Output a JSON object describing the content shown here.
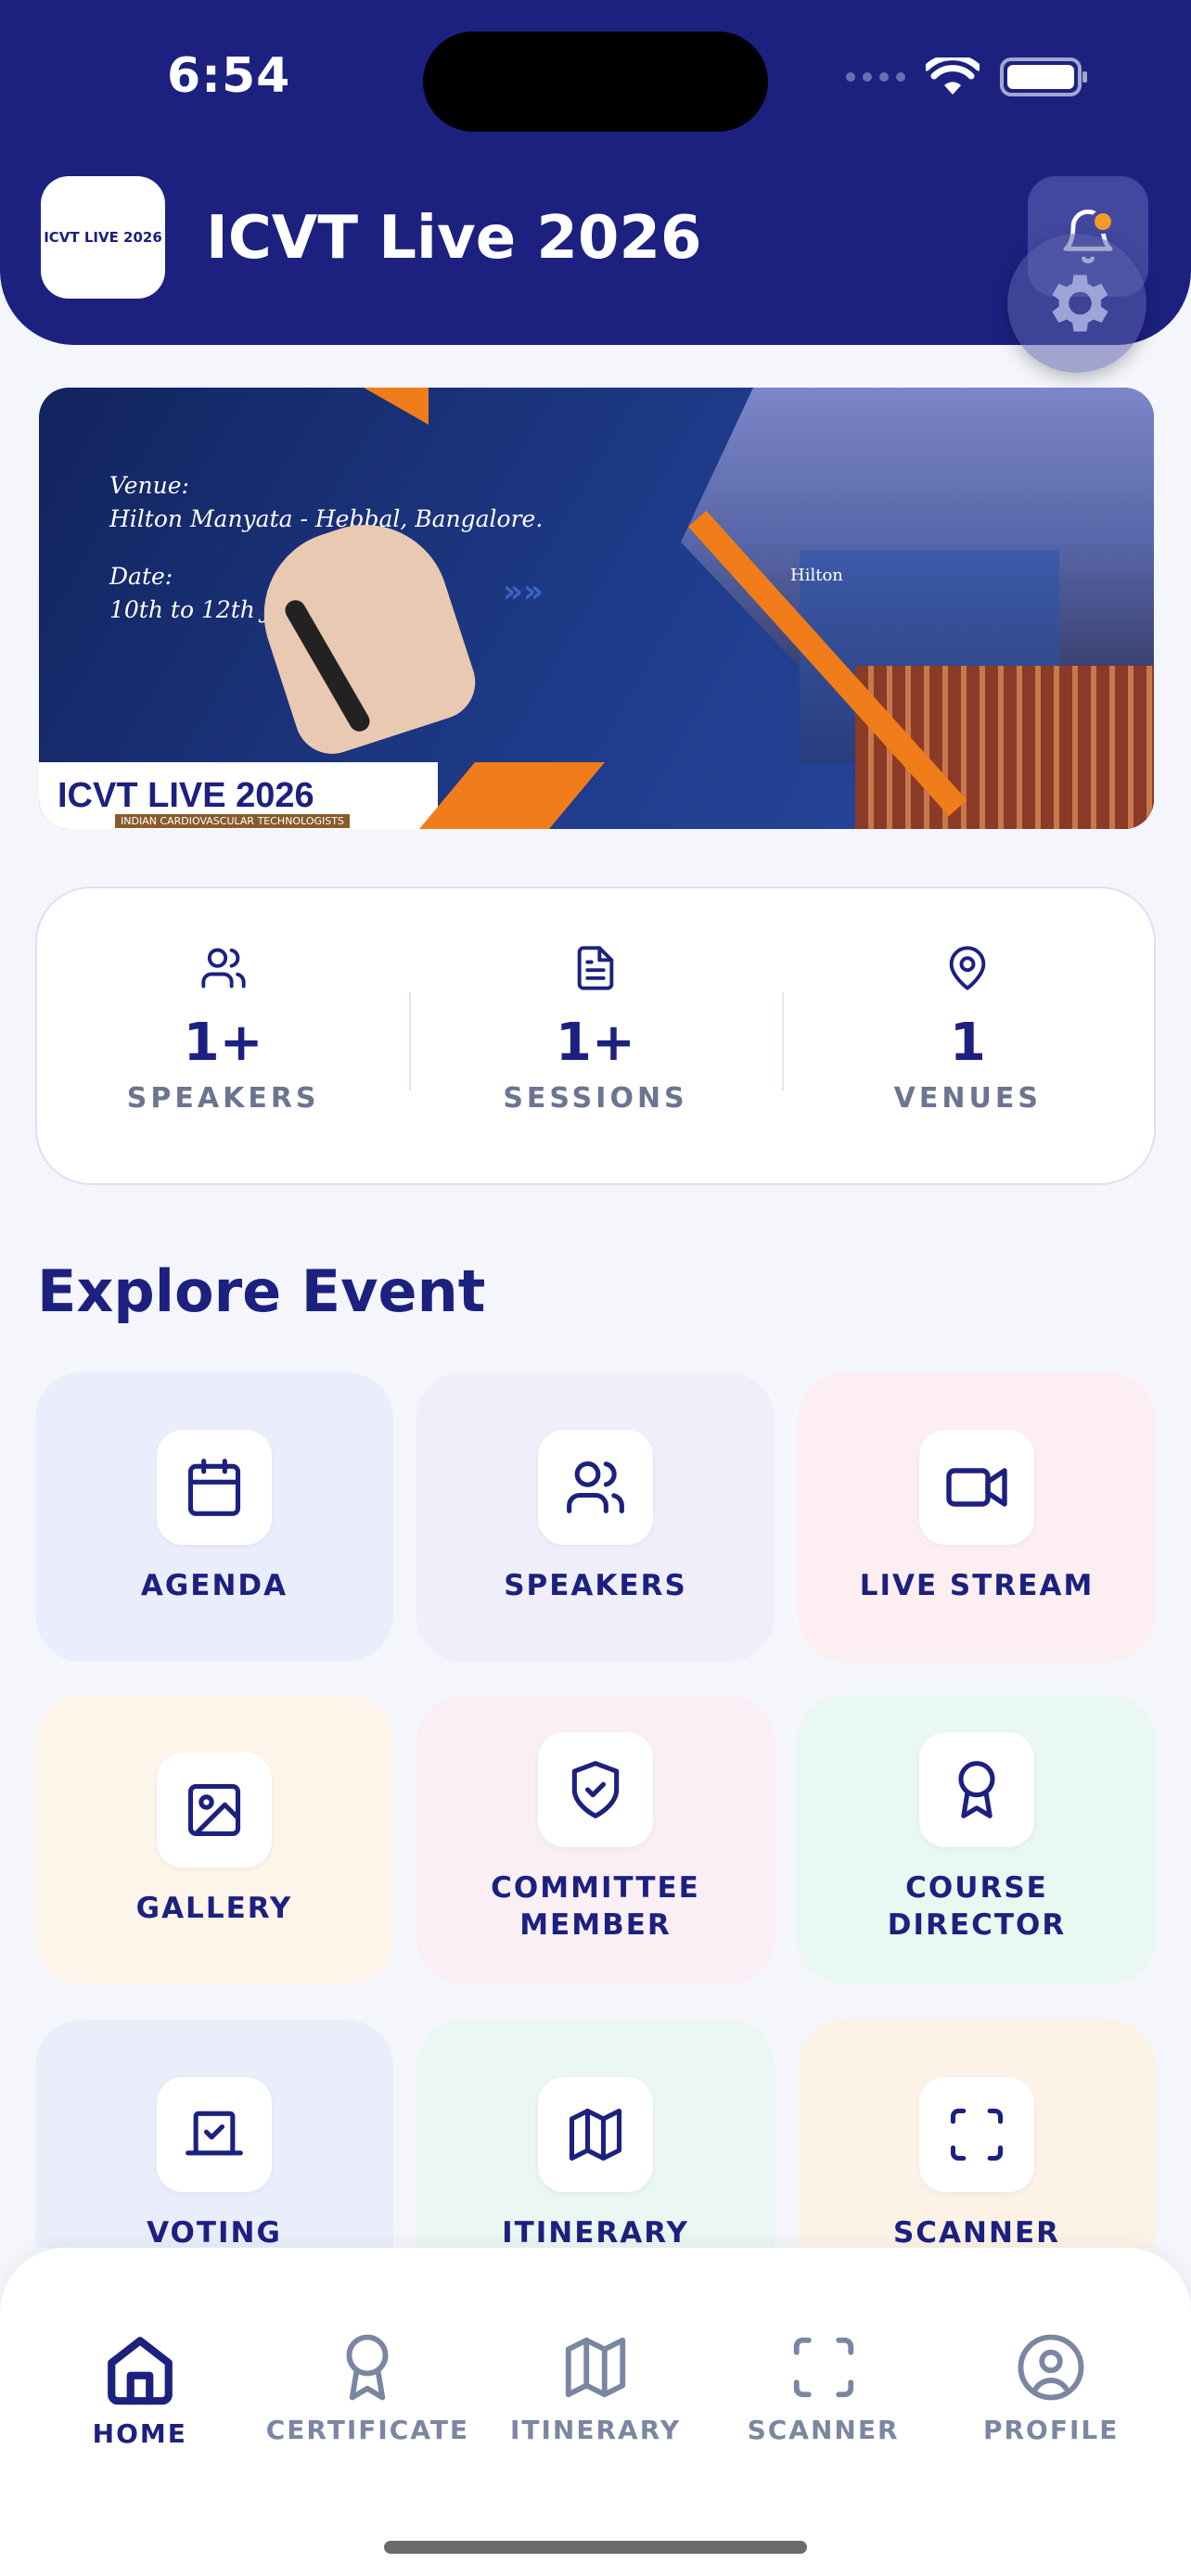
{
  "status_bar": {
    "time": "6:54"
  },
  "header": {
    "app_title": "ICVT Live 2026",
    "logo_text": "ICVT LIVE 2026",
    "logo_sub": "INDIAN CARDIOVASCULAR TECHNOLOGISTS",
    "icons": [
      "bell-icon",
      "gear-icon"
    ],
    "notification_dot_color": "#f39c2c"
  },
  "banner": {
    "venue_label": "Venue:",
    "venue_value": "Hilton Manyata - Hebbal, Bangalore.",
    "date_label": "Date:",
    "date_value": "10th to 12th J",
    "hotel_sign": "Hilton",
    "logo_title": "ICVT LIVE 2026",
    "logo_subtitle": "INDIAN CARDIOVASCULAR TECHNOLOGISTS"
  },
  "stats": [
    {
      "icon": "users-icon",
      "value": "1+",
      "label": "SPEAKERS"
    },
    {
      "icon": "document-icon",
      "value": "1+",
      "label": "SESSIONS"
    },
    {
      "icon": "map-pin-icon",
      "value": "1",
      "label": "VENUES"
    }
  ],
  "explore": {
    "title": "Explore Event",
    "tiles": [
      {
        "icon": "calendar-icon",
        "label": "AGENDA",
        "bg": "#eaeefc"
      },
      {
        "icon": "users-icon",
        "label": "SPEAKERS",
        "bg": "#efeffc"
      },
      {
        "icon": "video-icon",
        "label": "LIVE STREAM",
        "bg": "#fdeff1"
      },
      {
        "icon": "image-icon",
        "label": "GALLERY",
        "bg": "#fdf5ea"
      },
      {
        "icon": "shield-check-icon",
        "label": "COMMITTEE\nMEMBER",
        "bg": "#fbeff6"
      },
      {
        "icon": "award-icon",
        "label": "COURSE\nDIRECTOR",
        "bg": "#e9f8f0"
      },
      {
        "icon": "voting-icon",
        "label": "VOTING",
        "bg": "#eaeefb"
      },
      {
        "icon": "map-icon",
        "label": "ITINERARY",
        "bg": "#eaf7f2"
      },
      {
        "icon": "scanner-icon",
        "label": "SCANNER",
        "bg": "#fcf3e6"
      }
    ]
  },
  "bottom_nav": {
    "items": [
      {
        "icon": "home-icon",
        "label": "HOME",
        "active": true
      },
      {
        "icon": "award-icon",
        "label": "CERTIFICATE",
        "active": false
      },
      {
        "icon": "map-icon",
        "label": "ITINERARY",
        "active": false
      },
      {
        "icon": "scanner-icon",
        "label": "SCANNER",
        "active": false
      },
      {
        "icon": "profile-icon",
        "label": "PROFILE",
        "active": false
      }
    ]
  },
  "colors": {
    "primary": "#1c2180",
    "muted": "#7a86a2",
    "accent": "#f07c1a"
  }
}
